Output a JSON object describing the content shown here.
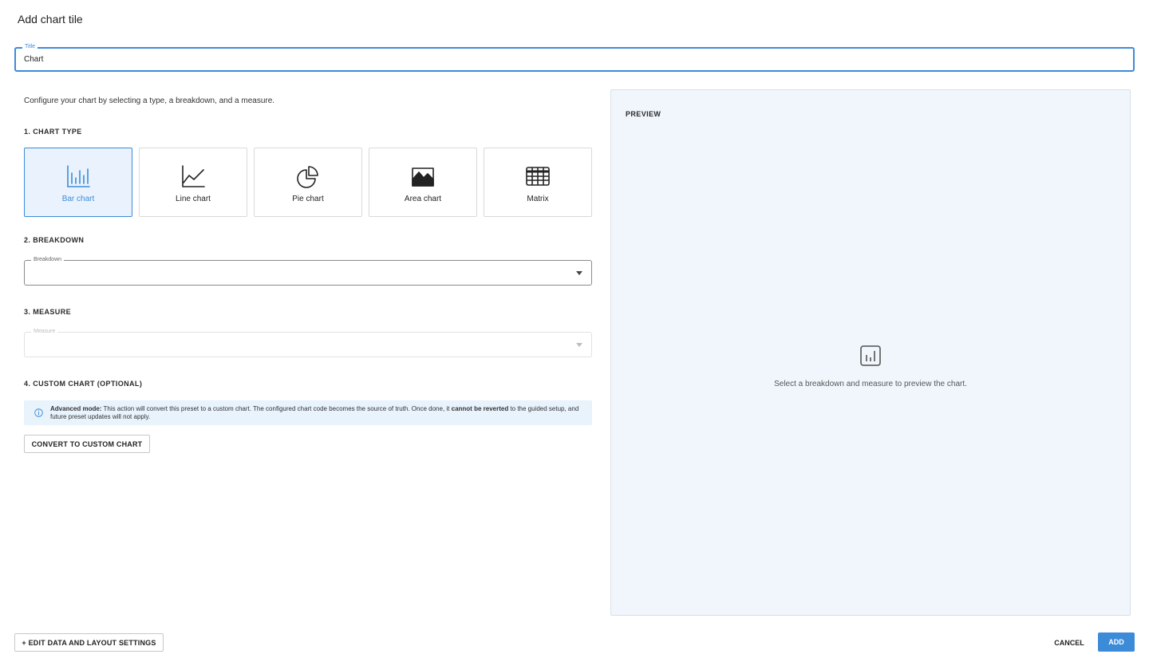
{
  "dialog": {
    "title": "Add chart tile"
  },
  "title_field": {
    "label": "Title",
    "value": "Chart"
  },
  "intro": "Configure your chart by selecting a type, a breakdown, and a measure.",
  "sections": {
    "chart_type": "1. CHART TYPE",
    "breakdown": "2. BREAKDOWN",
    "measure": "3. MEASURE",
    "custom": "4. CUSTOM CHART (OPTIONAL)"
  },
  "chart_types": [
    {
      "label": "Bar chart",
      "icon": "bar-chart-icon",
      "selected": true
    },
    {
      "label": "Line chart",
      "icon": "line-chart-icon",
      "selected": false
    },
    {
      "label": "Pie chart",
      "icon": "pie-chart-icon",
      "selected": false
    },
    {
      "label": "Area chart",
      "icon": "area-chart-icon",
      "selected": false
    },
    {
      "label": "Matrix",
      "icon": "matrix-icon",
      "selected": false
    }
  ],
  "breakdown_field": {
    "label": "Breakdown",
    "value": ""
  },
  "measure_field": {
    "label": "Measure",
    "value": "",
    "disabled": true
  },
  "info": {
    "bold_lead": "Advanced mode:",
    "text_1": " This action will convert this preset to a custom chart. The configured chart code becomes the source of truth. Once done, it ",
    "bold_mid": "cannot be reverted",
    "text_2": " to the guided setup, and future preset updates will not apply."
  },
  "convert_button": "CONVERT TO CUSTOM CHART",
  "preview": {
    "heading": "PREVIEW",
    "empty_text": "Select a breakdown and measure to preview the chart."
  },
  "footer": {
    "edit_settings": "+ EDIT DATA AND LAYOUT SETTINGS",
    "cancel": "CANCEL",
    "add": "ADD"
  },
  "colors": {
    "accent": "#3b8bd9",
    "preview_bg": "#f1f6fd",
    "info_bg": "#e8f3fc"
  }
}
